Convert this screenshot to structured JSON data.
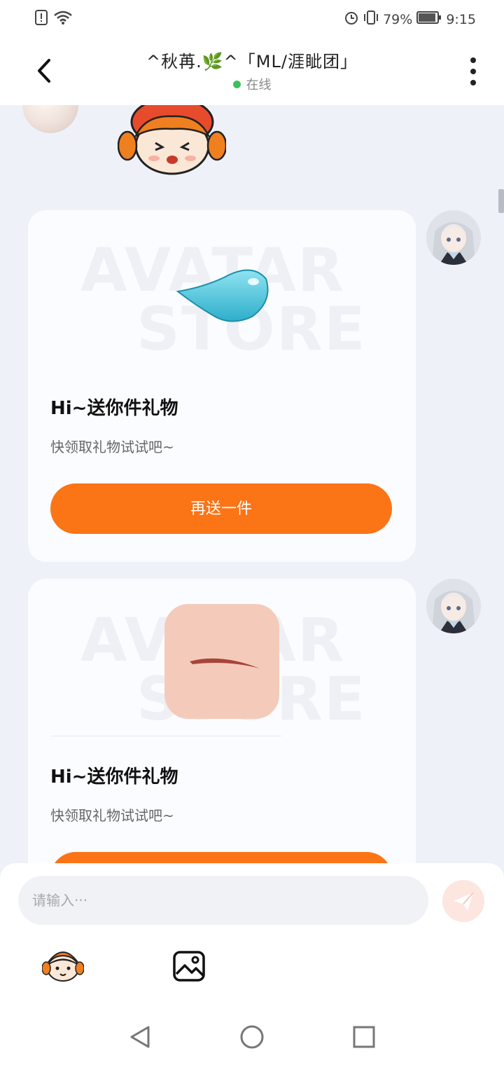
{
  "status_bar": {
    "battery": "79%",
    "time": "9:15"
  },
  "header": {
    "title": "^秋苒.🌿^「ML/涯眦团」",
    "status": "在线"
  },
  "cards": [
    {
      "title": "Hi~送你件礼物",
      "subtitle": "快领取礼物试试吧~",
      "button": "再送一件",
      "watermark": [
        "AVATAR",
        "STORE"
      ],
      "item_icon": "water-drop-item"
    },
    {
      "title": "Hi~送你件礼物",
      "subtitle": "快领取礼物试试吧~",
      "button": "",
      "watermark": [
        "AVATAR",
        "STORE"
      ],
      "item_icon": "eyebrow-item"
    }
  ],
  "input": {
    "placeholder": "请输入···"
  },
  "colors": {
    "accent": "#fb7416",
    "online": "#3bc15a",
    "background": "#eef1f8"
  }
}
